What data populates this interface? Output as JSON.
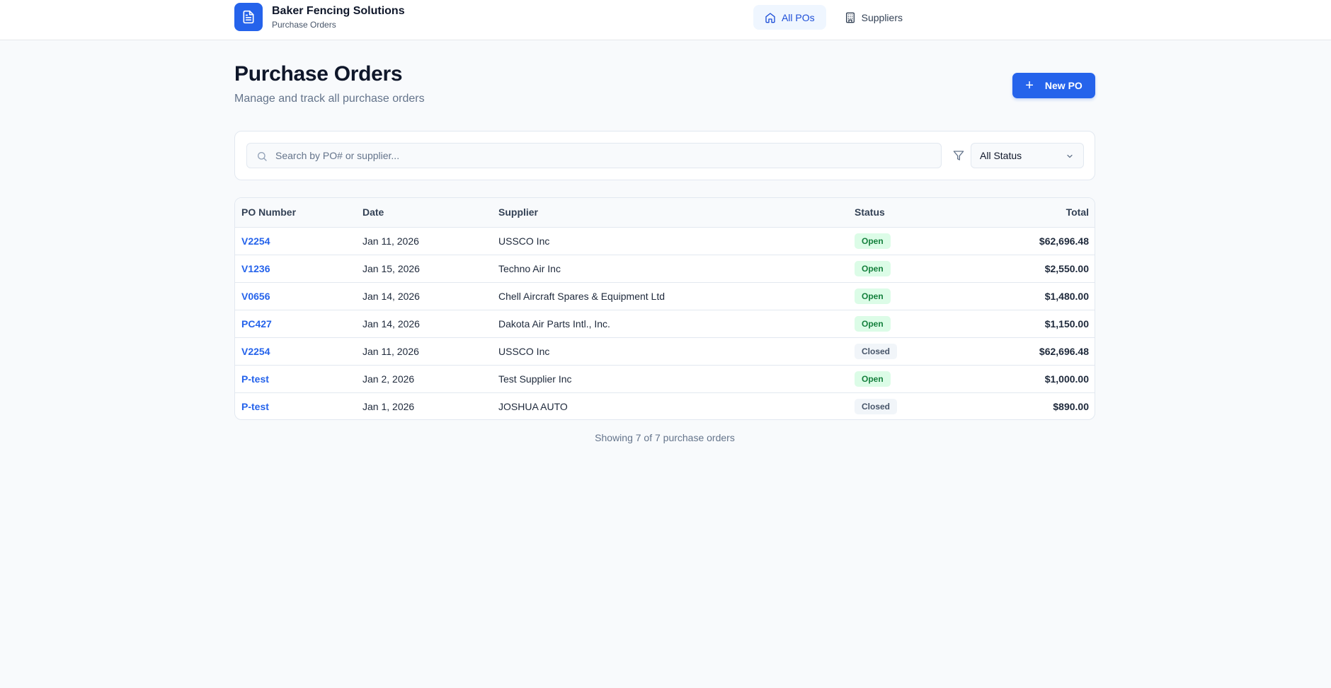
{
  "header": {
    "brand_name": "Baker Fencing Solutions",
    "brand_sub": "Purchase Orders",
    "nav": [
      {
        "label": "All POs",
        "icon": "home-icon",
        "active": true
      },
      {
        "label": "Suppliers",
        "icon": "building-icon",
        "active": false
      }
    ]
  },
  "page": {
    "title": "Purchase Orders",
    "subtitle": "Manage and track all purchase orders",
    "new_button": "New PO"
  },
  "filters": {
    "search_placeholder": "Search by PO# or supplier...",
    "status_value": "All Status"
  },
  "table": {
    "columns": [
      "PO Number",
      "Date",
      "Supplier",
      "Status",
      "Total"
    ],
    "rows": [
      {
        "po": "V2254",
        "date": "Jan 11, 2026",
        "supplier": "USSCO Inc",
        "status": "Open",
        "total": "$62,696.48"
      },
      {
        "po": "V1236",
        "date": "Jan 15, 2026",
        "supplier": "Techno Air Inc",
        "status": "Open",
        "total": "$2,550.00"
      },
      {
        "po": "V0656",
        "date": "Jan 14, 2026",
        "supplier": "Chell Aircraft Spares & Equipment Ltd",
        "status": "Open",
        "total": "$1,480.00"
      },
      {
        "po": "PC427",
        "date": "Jan 14, 2026",
        "supplier": "Dakota Air Parts Intl., Inc.",
        "status": "Open",
        "total": "$1,150.00"
      },
      {
        "po": "V2254",
        "date": "Jan 11, 2026",
        "supplier": "USSCO Inc",
        "status": "Closed",
        "total": "$62,696.48"
      },
      {
        "po": "P-test",
        "date": "Jan 2, 2026",
        "supplier": "Test Supplier Inc",
        "status": "Open",
        "total": "$1,000.00"
      },
      {
        "po": "P-test",
        "date": "Jan 1, 2026",
        "supplier": "JOSHUA AUTO",
        "status": "Closed",
        "total": "$890.00"
      }
    ]
  },
  "footer": {
    "count_text": "Showing 7 of 7 purchase orders"
  },
  "colors": {
    "accent": "#2563eb",
    "open_bg": "#dcfce7",
    "open_text": "#15803d",
    "closed_bg": "#f1f5f9",
    "closed_text": "#475569"
  }
}
